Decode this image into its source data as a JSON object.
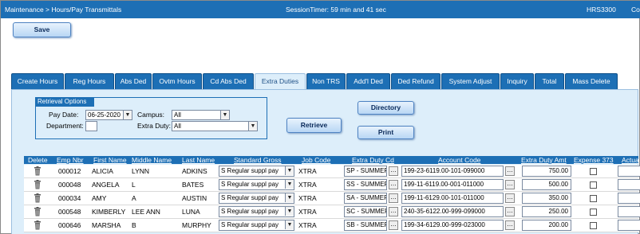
{
  "topbar": {
    "breadcrumb": "Maintenance > Hours/Pay Transmittals",
    "session_timer": "SessionTimer: 59 min and 41 sec",
    "screen_id": "HRS3300",
    "right_text": "Co"
  },
  "buttons": {
    "save": "Save",
    "retrieve": "Retrieve",
    "directory": "Directory",
    "print": "Print"
  },
  "tabs": [
    {
      "label": "Create Hours"
    },
    {
      "label": "Reg Hours"
    },
    {
      "label": "Abs Ded"
    },
    {
      "label": "Ovtm Hours"
    },
    {
      "label": "Cd Abs Ded"
    },
    {
      "label": "Extra Duties"
    },
    {
      "label": "Non TRS"
    },
    {
      "label": "Add'l Ded"
    },
    {
      "label": "Ded Refund"
    },
    {
      "label": "System Adjust"
    },
    {
      "label": "Inquiry"
    },
    {
      "label": "Total"
    },
    {
      "label": "Mass Delete"
    }
  ],
  "active_tab": "Extra Duties",
  "retrieval": {
    "title": "Retrieval Options",
    "pay_date_label": "Pay Date:",
    "pay_date_value": "06-25-2020",
    "campus_label": "Campus:",
    "campus_value": "All",
    "department_label": "Department:",
    "department_value": "",
    "extra_duty_label": "Extra Duty:",
    "extra_duty_value": "All"
  },
  "grid": {
    "headers": {
      "delete": "Delete",
      "emp_nbr": "Emp Nbr",
      "first_name": "First Name",
      "middle_name": "Middle Name",
      "last_name": "Last Name",
      "standard_gross": "Standard Gross",
      "job_code": "Job Code",
      "extra_duty_cd": "Extra Duty Cd",
      "account_code": "Account Code",
      "extra_duty_amt": "Extra Duty Amt",
      "expense_373": "Expense 373",
      "actual": "Actua"
    },
    "rows": [
      {
        "emp_nbr": "000012",
        "first_name": "ALICIA",
        "middle_name": "LYNN",
        "last_name": "ADKINS",
        "standard_gross": "S Regular suppl pay",
        "job_code": "XTRA",
        "extra_duty_cd": "SP - SUMMEF",
        "account_code": "199-23-6119.00-101-099000",
        "amount": "750.00"
      },
      {
        "emp_nbr": "000048",
        "first_name": "ANGELA",
        "middle_name": "L",
        "last_name": "BATES",
        "standard_gross": "S Regular suppl pay",
        "job_code": "XTRA",
        "extra_duty_cd": "SS - SUMMEF",
        "account_code": "199-11-6119.00-001-011000",
        "amount": "500.00"
      },
      {
        "emp_nbr": "000034",
        "first_name": "AMY",
        "middle_name": "A",
        "last_name": "AUSTIN",
        "standard_gross": "S Regular suppl pay",
        "job_code": "XTRA",
        "extra_duty_cd": "SA - SUMMEF",
        "account_code": "199-11-6129.00-101-011000",
        "amount": "350.00"
      },
      {
        "emp_nbr": "000548",
        "first_name": "KIMBERLY",
        "middle_name": "LEE ANN",
        "last_name": "LUNA",
        "standard_gross": "S Regular suppl pay",
        "job_code": "XTRA",
        "extra_duty_cd": "SC - SUMMEF",
        "account_code": "240-35-6122.00-999-099000",
        "amount": "250.00"
      },
      {
        "emp_nbr": "000646",
        "first_name": "MARSHA",
        "middle_name": "B",
        "last_name": "MURPHY",
        "standard_gross": "S Regular suppl pay",
        "job_code": "XTRA",
        "extra_duty_cd": "SB - SUMMEF",
        "account_code": "199-34-6129.00-999-023000",
        "amount": "200.00"
      }
    ]
  },
  "icons": {
    "delete": "trash-icon",
    "dropdown": "chevron-down-icon",
    "lookup": "ellipsis-icon"
  },
  "colors": {
    "header_blue": "#1d6fb5",
    "panel_bg": "#ddeefa"
  }
}
